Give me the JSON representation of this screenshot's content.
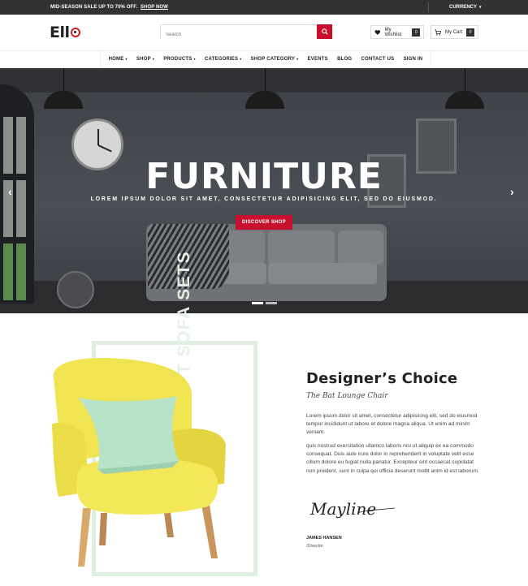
{
  "topbar": {
    "promo_text": "MID-SEASON SALE UP TO 70% OFF.",
    "promo_link": "SHOP NOW",
    "currency_label": "CURRENCY"
  },
  "header": {
    "logo_text": "Ell",
    "search_placeholder": "Search",
    "wishlist_label": "My Wishlist",
    "wishlist_count": "0",
    "cart_label": "My Cart",
    "cart_count": "0"
  },
  "nav": {
    "items": [
      {
        "label": "HOME",
        "dropdown": true
      },
      {
        "label": "SHOP",
        "dropdown": true
      },
      {
        "label": "PRODUCTS",
        "dropdown": true
      },
      {
        "label": "CATEGORIES",
        "dropdown": true
      },
      {
        "label": "SHOP CATEGORY",
        "dropdown": true
      },
      {
        "label": "EVENTS",
        "dropdown": false
      },
      {
        "label": "BLOG",
        "dropdown": false
      },
      {
        "label": "CONTACT US",
        "dropdown": false
      },
      {
        "label": "SIGN IN",
        "dropdown": false
      }
    ]
  },
  "hero": {
    "title": "FURNITURE",
    "subtitle": "LOREM IPSUM DOLOR SIT AMET, CONSECTETUR ADIPISICING ELIT, SED DO EIUSMOD.",
    "button_label": "DISCOVER SHOP",
    "prev_arrow": "‹",
    "next_arrow": "›",
    "slides_total": 2,
    "active_slide": 1
  },
  "feature": {
    "vertical_text": "CONCEPT SOFA SETS",
    "title": "Designer’s Choice",
    "subtitle": "The Bat Lounge Chair",
    "paragraph1": "Lorem ipsum dolor sit amet, consectetur adipisicing elit, sed do eiusmod tempor incididunt ut labore et dolore magna aliqua. Ut enim ad minim veniam.",
    "paragraph2": "quis nostrud exercitation ullamco laboris nisi ut aliquip ex ea commodo consequat. Duis aute irure dolor in reprehenderit in voluptate velit esse cillum dolore eu fugiat nulla pariatur. Excepteur sint occaecat cupidatat non proident, sunt in culpa qui officia deserunt mollit anim id est laborum.",
    "signature_text": "Mayline",
    "author_name": "JAMES HANSEN",
    "author_role": "/Director"
  },
  "colors": {
    "accent": "#c8102e",
    "topbar_bg": "#323232",
    "frame_green": "#dff0e1",
    "chair_yellow": "#f2e65a",
    "pillow_mint": "#b7e3c8"
  }
}
